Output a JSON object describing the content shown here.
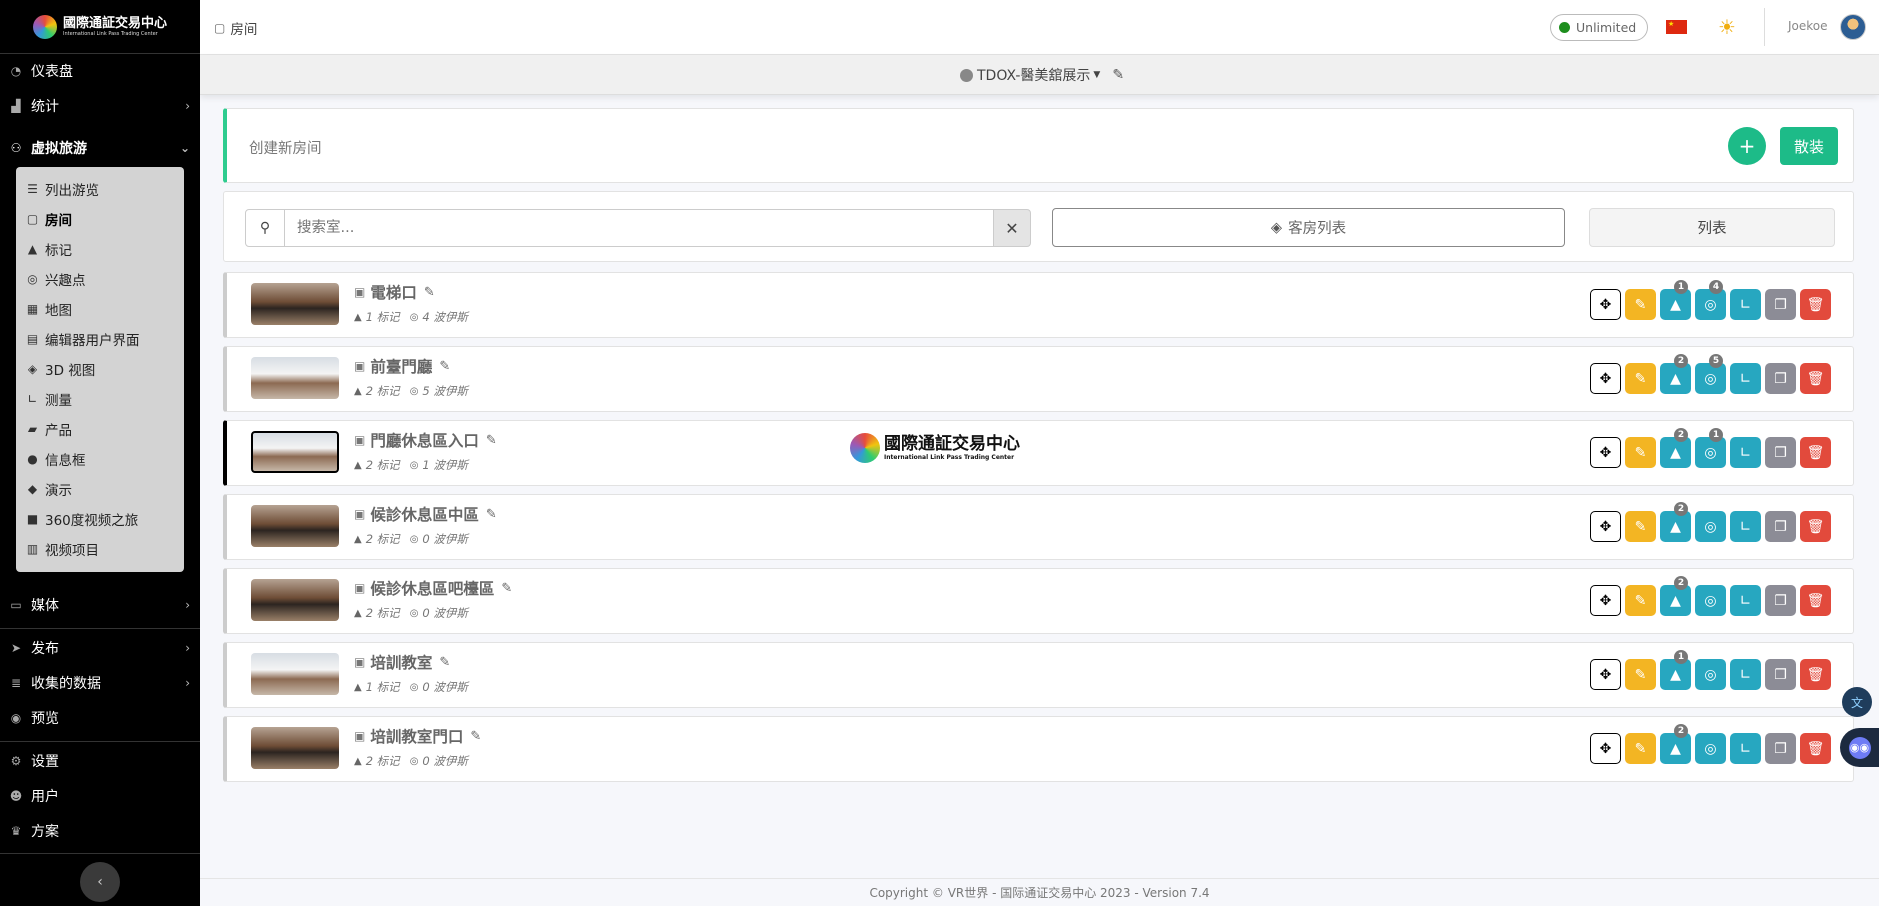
{
  "sidebar": {
    "logo": {
      "cn": "國際通証交易中心",
      "en": "International Link Pass Trading Center"
    },
    "items_top": [
      {
        "label": "仪表盘",
        "icon": "dashboard-icon",
        "chevron": ""
      },
      {
        "label": "统计",
        "icon": "chart-icon",
        "chevron": "›"
      },
      {
        "label": "虚拟旅游",
        "icon": "tour-icon",
        "chevron": "⌄"
      }
    ],
    "submenu": [
      {
        "label": "列出游览",
        "icon": "list-icon"
      },
      {
        "label": "房间",
        "icon": "room-icon"
      },
      {
        "label": "标记",
        "icon": "marker-icon"
      },
      {
        "label": "兴趣点",
        "icon": "poi-icon"
      },
      {
        "label": "地图",
        "icon": "map-icon"
      },
      {
        "label": "编辑器用户界面",
        "icon": "editor-ui-icon"
      },
      {
        "label": "3D 视图",
        "icon": "cube-icon"
      },
      {
        "label": "测量",
        "icon": "ruler-icon"
      },
      {
        "label": "产品",
        "icon": "cart-icon"
      },
      {
        "label": "信息框",
        "icon": "info-icon"
      },
      {
        "label": "演示",
        "icon": "presentation-icon"
      },
      {
        "label": "360度视频之旅",
        "icon": "video-icon"
      },
      {
        "label": "视频项目",
        "icon": "film-icon"
      }
    ],
    "items_bottom": [
      {
        "label": "媒体",
        "icon": "media-icon",
        "chevron": "›"
      },
      {
        "label": "发布",
        "icon": "publish-icon",
        "chevron": "›"
      },
      {
        "label": "收集的数据",
        "icon": "data-icon",
        "chevron": "›"
      },
      {
        "label": "预览",
        "icon": "eye-icon",
        "chevron": ""
      },
      {
        "label": "设置",
        "icon": "gear-icon",
        "chevron": ""
      },
      {
        "label": "用户",
        "icon": "users-icon",
        "chevron": ""
      },
      {
        "label": "方案",
        "icon": "crown-icon",
        "chevron": ""
      }
    ],
    "collapse": "‹"
  },
  "topbar": {
    "breadcrumb": "房间",
    "plan_badge": "Unlimited",
    "user_name": "Joekoe"
  },
  "tour": {
    "name": "TDOX-醫美舘展示"
  },
  "create": {
    "label": "创建新房间",
    "plus": "+",
    "bulk_label": "散装"
  },
  "search": {
    "placeholder": "搜索室...",
    "room_list_label": "客房列表",
    "list_label": "列表"
  },
  "rooms": [
    {
      "name": "電梯口",
      "markers": "1 标记",
      "pois": "4 波伊斯",
      "badge_markers": "1",
      "badge_pois": "4"
    },
    {
      "name": "前臺門廳",
      "markers": "2 标记",
      "pois": "5 波伊斯",
      "badge_markers": "2",
      "badge_pois": "5"
    },
    {
      "name": "門廳休息區入口",
      "markers": "2 标记",
      "pois": "1 波伊斯",
      "badge_markers": "2",
      "badge_pois": "1"
    },
    {
      "name": "候診休息區中區",
      "markers": "2 标记",
      "pois": "0 波伊斯",
      "badge_markers": "2",
      "badge_pois": ""
    },
    {
      "name": "候診休息區吧檯區",
      "markers": "2 标记",
      "pois": "0 波伊斯",
      "badge_markers": "2",
      "badge_pois": ""
    },
    {
      "name": "培訓教室",
      "markers": "1 标记",
      "pois": "0 波伊斯",
      "badge_markers": "1",
      "badge_pois": ""
    },
    {
      "name": "培訓教室門口",
      "markers": "2 标记",
      "pois": "0 波伊斯",
      "badge_markers": "2",
      "badge_pois": ""
    }
  ],
  "brand_overlay": {
    "cn": "國際通証交易中心",
    "en": "International Link Pass Trading Center"
  },
  "footer": {
    "text": "Copyright © VR世界 - 国际通证交易中心 2023 - Version 7.4"
  },
  "colors": {
    "accent_green": "#1dbb88",
    "edit_yellow": "#f3b523",
    "teal": "#27a7c0",
    "danger": "#e24a3c",
    "sidebar_bg": "#000000"
  }
}
